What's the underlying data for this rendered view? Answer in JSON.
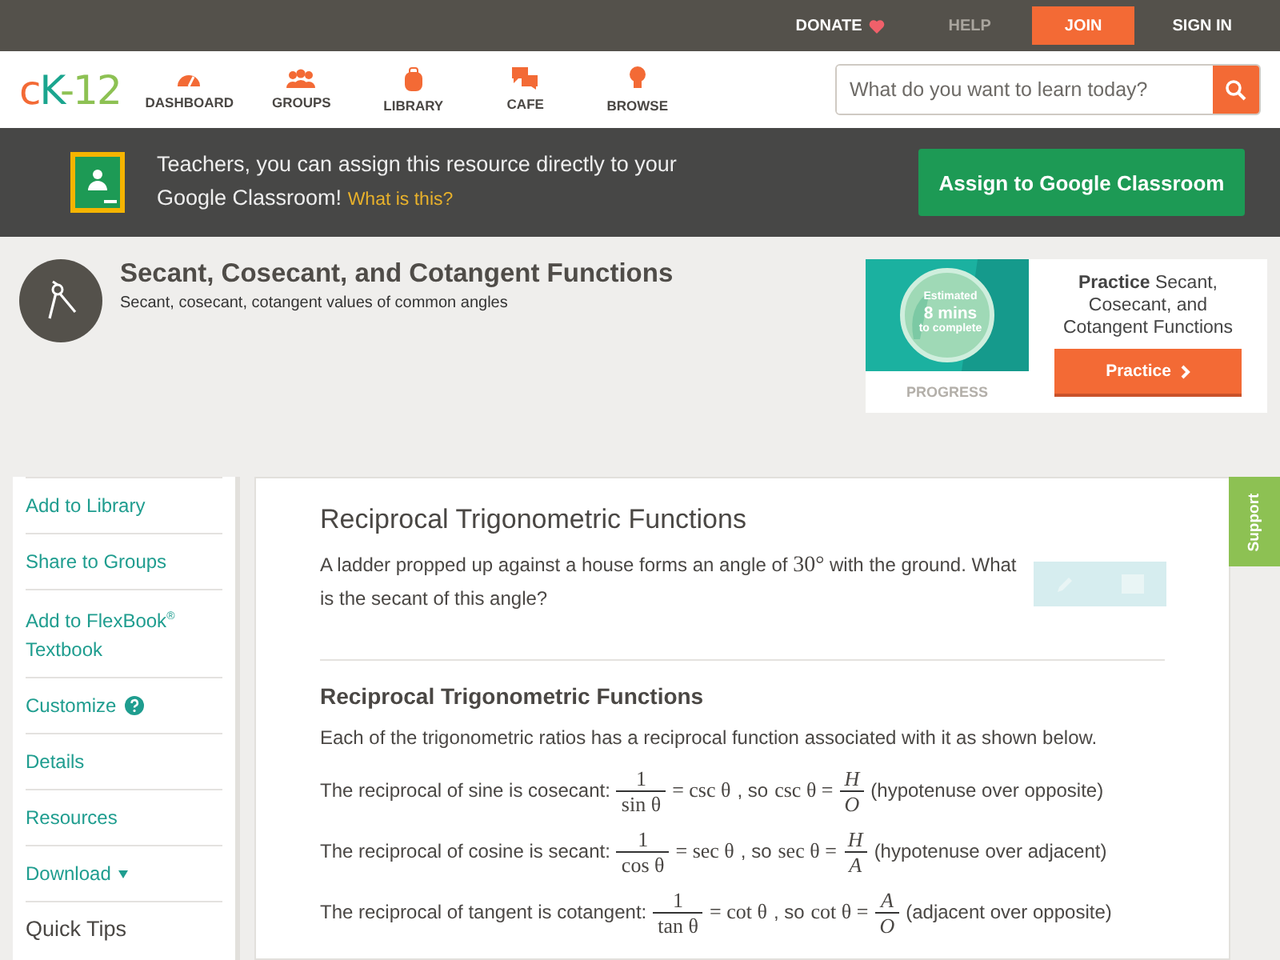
{
  "top_links": [
    {
      "label": "DONATE",
      "kind": "donate"
    },
    {
      "label": "HELP",
      "kind": "muted"
    },
    {
      "label": "JOIN",
      "kind": "primary"
    },
    {
      "label": "SIGN IN",
      "kind": "plain"
    }
  ],
  "logo": {
    "c": "c",
    "k": "K",
    "rest": "-12"
  },
  "nav": [
    {
      "label": "DASHBOARD"
    },
    {
      "label": "GROUPS"
    },
    {
      "label": "LIBRARY"
    },
    {
      "label": "CAFE"
    },
    {
      "label": "BROWSE"
    }
  ],
  "search": {
    "placeholder": "What do you want to learn today?"
  },
  "classroom_banner": {
    "text": "Teachers, you can assign this resource directly to your Google Classroom!",
    "link": "What is this?",
    "button": "Assign to Google Classroom"
  },
  "concept": {
    "title": "Secant, Cosecant, and Cotangent Functions",
    "subtitle": "Secant, cosecant, cotangent values of common angles"
  },
  "practice_card": {
    "estimate": [
      "Estimated",
      "8 mins",
      "to complete"
    ],
    "progress": "PROGRESS",
    "text": "**Practice** Secant, Cosecant, and Cotangent Functions",
    "button": "Practice"
  },
  "sidebar": [
    {
      "label": "Add to Library",
      "kind": "link"
    },
    {
      "label": "Share to Groups",
      "kind": "link"
    },
    {
      "label": "Add to FlexBook$^{®}$ Textbook",
      "kind": "link"
    },
    {
      "label": "Customize",
      "kind": "help"
    },
    {
      "label": "Details",
      "kind": "link"
    },
    {
      "label": "Resources",
      "kind": "link"
    },
    {
      "label": "Download",
      "kind": "dropdown"
    },
    {
      "label": "Quick Tips",
      "kind": "heading"
    }
  ],
  "support_tab": "Support",
  "lesson": {
    "title": "Reciprocal Trigonometric Functions",
    "question_before": "A ladder propped up against a house forms an angle of",
    "angle": "30°",
    "question_after": "with the ground. What is the secant of this angle?",
    "section": "Reciprocal Trigonometric Functions",
    "intro": "Each of the trigonometric ratios has a reciprocal function associated with it as shown below.",
    "formulas": [
      {
        "lead": "The reciprocal of sine is cosecant:",
        "num": "1",
        "den": "sin θ",
        "eq": "= csc θ",
        "so": ", so",
        "lhs": "csc θ =",
        "fnum": "H",
        "fden": "O",
        "note": "(hypotenuse over opposite)"
      },
      {
        "lead": "The reciprocal of cosine is secant:",
        "num": "1",
        "den": "cos θ",
        "eq": "= sec θ",
        "so": ", so",
        "lhs": "sec θ =",
        "fnum": "H",
        "fden": "A",
        "note": "(hypotenuse over adjacent)"
      },
      {
        "lead": "The reciprocal of tangent is cotangent:",
        "num": "1",
        "den": "tan θ",
        "eq": "= cot θ",
        "so": ", so",
        "lhs": "cot θ =",
        "fnum": "A",
        "fden": "O",
        "note": "(adjacent over opposite)"
      }
    ]
  }
}
